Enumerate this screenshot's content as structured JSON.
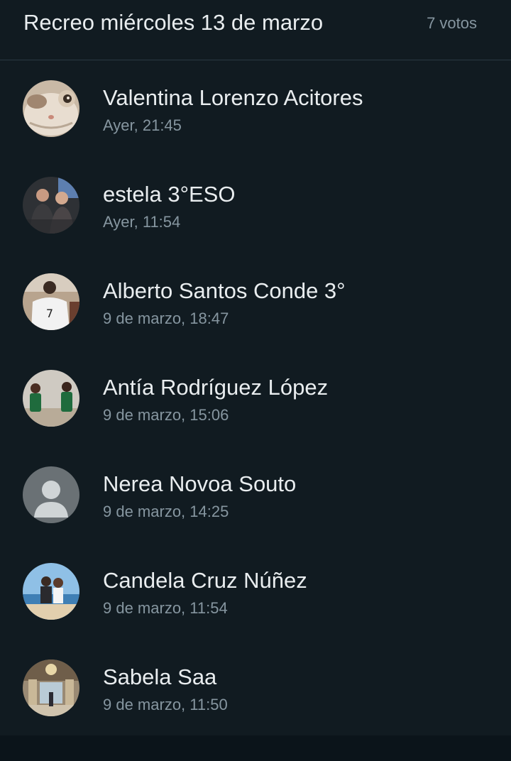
{
  "header": {
    "title": "Recreo miércoles 13 de marzo",
    "votes": "7 votos"
  },
  "voters": [
    {
      "name": "Valentina Lorenzo Acitores",
      "time": "Ayer, 21:45",
      "avatar": "cat-photo-avatar"
    },
    {
      "name": "estela 3°ESO",
      "time": "Ayer, 11:54",
      "avatar": "friends-photo-avatar"
    },
    {
      "name": "Alberto Santos Conde 3°",
      "time": "9 de marzo, 18:47",
      "avatar": "jersey-photo-avatar"
    },
    {
      "name": "Antía Rodríguez López",
      "time": "9 de marzo, 15:06",
      "avatar": "basketball-players-photo-avatar"
    },
    {
      "name": "Nerea Novoa Souto",
      "time": "9 de marzo, 14:25",
      "avatar": "default-person-icon"
    },
    {
      "name": "Candela Cruz Núñez",
      "time": "9 de marzo, 11:54",
      "avatar": "couple-beach-photo-avatar"
    },
    {
      "name": "Sabela Saa",
      "time": "9 de marzo, 11:50",
      "avatar": "palace-hall-photo-avatar"
    }
  ],
  "colors": {
    "background": "#111b21",
    "primary_text": "#e9edef",
    "secondary_text": "#8696a0",
    "divider": "#2a3942",
    "default_avatar_bg": "#6a7175"
  }
}
